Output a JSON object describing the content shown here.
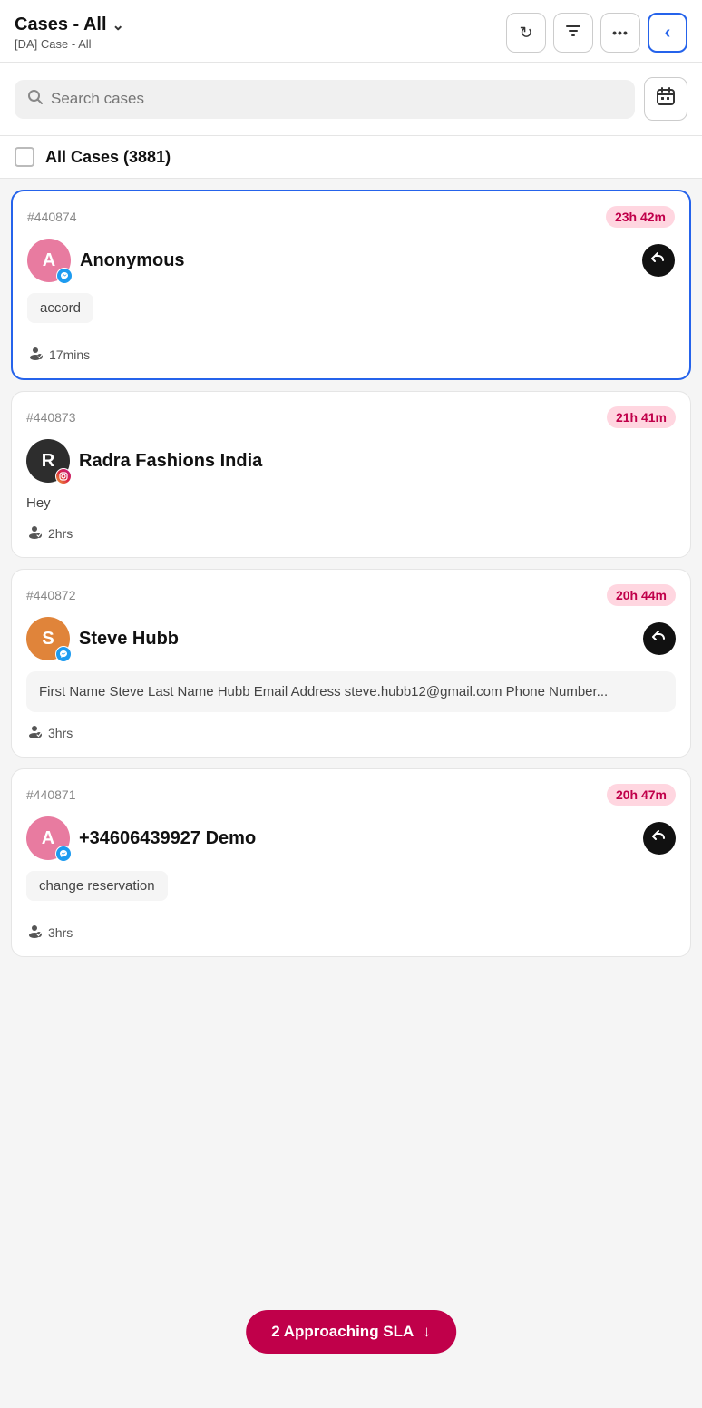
{
  "header": {
    "title": "Cases - All",
    "subtitle": "[DA] Case - All",
    "refresh_icon": "↻",
    "filter_icon": "⚗",
    "more_icon": "•••",
    "back_icon": "‹"
  },
  "search": {
    "placeholder": "Search cases",
    "calendar_icon": "📅"
  },
  "all_cases": {
    "label": "All Cases (3881)"
  },
  "cases": [
    {
      "id": "#440874",
      "time_badge": "23h 42m",
      "avatar_letter": "A",
      "avatar_color": "pink",
      "channel": "messenger",
      "contact_name": "Anonymous",
      "has_reply_icon": true,
      "message_type": "tag",
      "message": "accord",
      "agent_time": "17mins",
      "selected": true
    },
    {
      "id": "#440873",
      "time_badge": "21h 41m",
      "avatar_letter": "R",
      "avatar_color": "dark",
      "channel": "instagram",
      "contact_name": "Radra Fashions India",
      "has_reply_icon": false,
      "message_type": "plain",
      "message": "Hey",
      "agent_time": "2hrs",
      "selected": false
    },
    {
      "id": "#440872",
      "time_badge": "20h 44m",
      "avatar_letter": "S",
      "avatar_color": "orange",
      "channel": "messenger",
      "contact_name": "Steve Hubb",
      "has_reply_icon": true,
      "message_type": "box",
      "message": "First Name Steve Last Name Hubb Email Address steve.hubb12@gmail.com Phone Number...",
      "agent_time": "3hrs",
      "selected": false
    },
    {
      "id": "#440871",
      "time_badge": "20h 47m",
      "avatar_letter": "A",
      "avatar_color": "pink",
      "channel": "messenger",
      "contact_name": "+34606439927 Demo",
      "has_reply_icon": true,
      "message_type": "tag",
      "message": "change reservation",
      "agent_time": "3hrs",
      "selected": false
    }
  ],
  "sla_banner": {
    "label": "2 Approaching SLA",
    "arrow": "↓"
  }
}
